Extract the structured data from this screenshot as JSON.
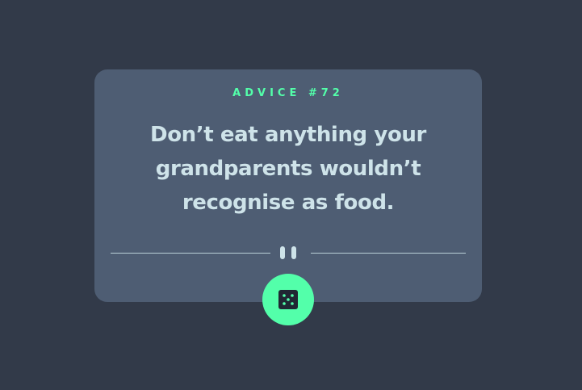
{
  "advice": {
    "id_label": "ADVICE #72",
    "text": "Don’t eat anything your grandparents wouldn’t recognise as food."
  },
  "colors": {
    "background": "#323a49",
    "card": "#4e5d73",
    "accent": "#53ffaa",
    "text": "#cee3e9"
  },
  "icons": {
    "divider": "pause-icon",
    "button": "dice-icon"
  }
}
